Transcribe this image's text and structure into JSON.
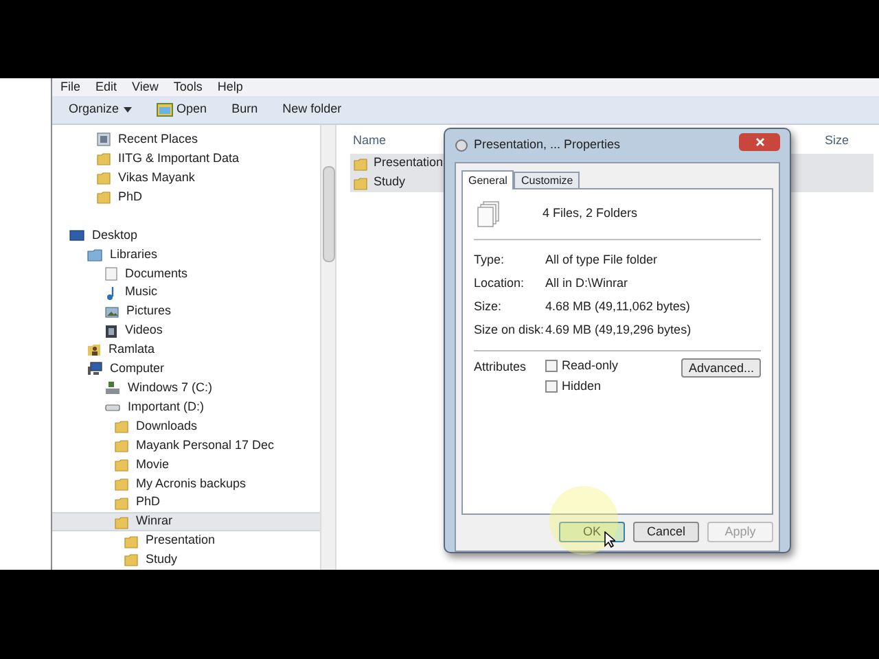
{
  "menu": [
    "File",
    "Edit",
    "View",
    "Tools",
    "Help"
  ],
  "toolbar": [
    {
      "label": "Organize",
      "kind": "dropdown"
    },
    {
      "label": "Open",
      "kind": "icon"
    },
    {
      "label": "Burn",
      "kind": "plain"
    },
    {
      "label": "New folder",
      "kind": "plain"
    }
  ],
  "favorites": [
    {
      "label": "Recent Places",
      "kind": "recent"
    },
    {
      "label": "IITG & Important Data",
      "kind": "folder"
    },
    {
      "label": "Vikas Mayank",
      "kind": "folder"
    },
    {
      "label": "PhD",
      "kind": "folder"
    }
  ],
  "tree": [
    {
      "label": "Desktop",
      "kind": "desktop",
      "selected": false,
      "children": [
        {
          "label": "Libraries",
          "kind": "libraries",
          "selected": false,
          "children": [
            {
              "label": "Documents",
              "kind": "documents",
              "selected": false
            },
            {
              "label": "Music",
              "kind": "music",
              "selected": false
            },
            {
              "label": "Pictures",
              "kind": "pictures",
              "selected": false
            },
            {
              "label": "Videos",
              "kind": "videos",
              "selected": false
            }
          ]
        },
        {
          "label": "Ramlata",
          "kind": "user",
          "selected": false
        },
        {
          "label": "Computer",
          "kind": "computer",
          "selected": false,
          "children": [
            {
              "label": "Windows 7 (C:)",
              "kind": "systemdrive",
              "selected": false
            },
            {
              "label": "Important (D:)",
              "kind": "drive",
              "selected": false,
              "children": [
                {
                  "label": "Downloads",
                  "kind": "folder",
                  "selected": false
                },
                {
                  "label": "Mayank Personal 17 Dec",
                  "kind": "folder",
                  "selected": false
                },
                {
                  "label": "Movie",
                  "kind": "folder",
                  "selected": false
                },
                {
                  "label": "My Acronis backups",
                  "kind": "folder",
                  "selected": false
                },
                {
                  "label": "PhD",
                  "kind": "folder",
                  "selected": false
                },
                {
                  "label": "Winrar",
                  "kind": "folder",
                  "selected": true,
                  "children": [
                    {
                      "label": "Presentation",
                      "kind": "folder",
                      "selected": false
                    },
                    {
                      "label": "Study",
                      "kind": "folder",
                      "selected": false
                    }
                  ]
                }
              ]
            }
          ]
        }
      ]
    }
  ],
  "columns": [
    "Name",
    "Size"
  ],
  "files": [
    {
      "name": "Presentation",
      "selected": true
    },
    {
      "name": "Study",
      "selected": true
    }
  ],
  "dialog": {
    "title": "Presentation, ... Properties",
    "tabs": [
      {
        "label": "General",
        "selected": true
      },
      {
        "label": "Customize",
        "selected": false
      }
    ],
    "summary": "4 Files, 2 Folders",
    "properties": [
      {
        "label": "Type:",
        "value": "All of type File folder"
      },
      {
        "label": "Location:",
        "value": "All in D:\\Winrar"
      },
      {
        "label": "Size:",
        "value": "4.68 MB (49,11,062 bytes)"
      },
      {
        "label": "Size on disk:",
        "value": "4.69 MB (49,19,296 bytes)"
      }
    ],
    "attributes_label": "Attributes",
    "attributes": [
      {
        "label": "Read-only",
        "checked": false
      },
      {
        "label": "Hidden",
        "checked": false
      }
    ],
    "advanced": "Advanced...",
    "buttons": [
      {
        "label": "OK",
        "default": true,
        "disabled": false
      },
      {
        "label": "Cancel",
        "default": false,
        "disabled": false
      },
      {
        "label": "Apply",
        "default": false,
        "disabled": true
      }
    ]
  }
}
